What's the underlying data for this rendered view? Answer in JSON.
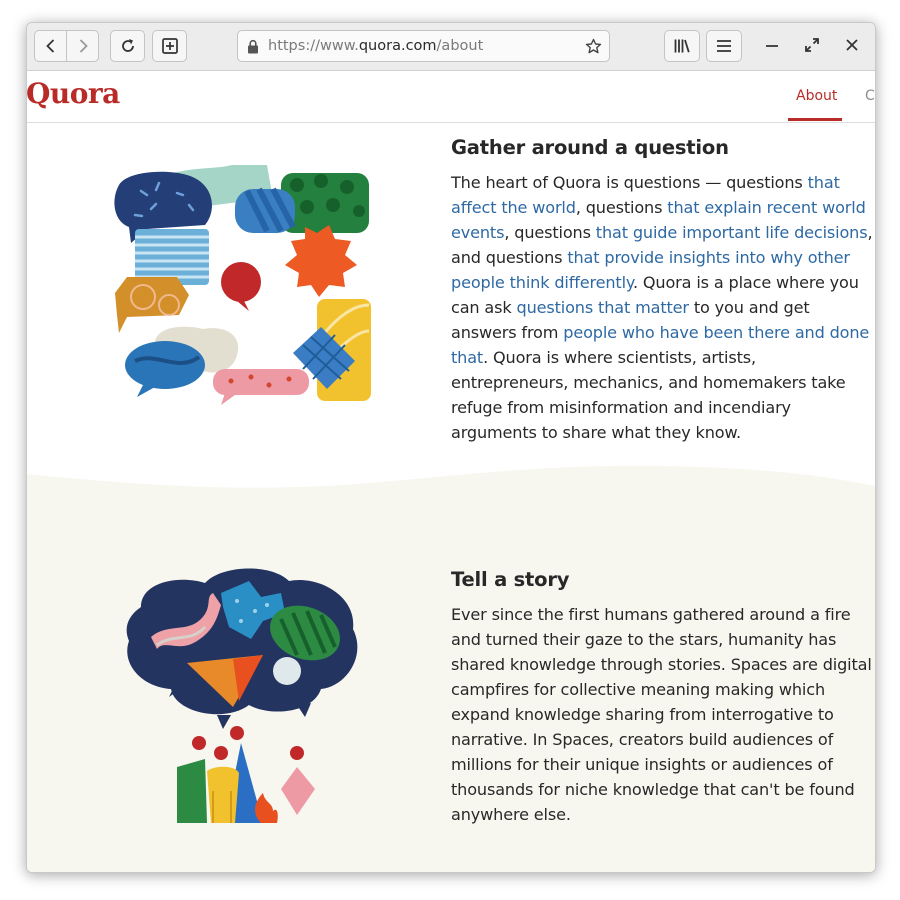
{
  "browser": {
    "url_prefix": "https://www.",
    "url_host": "quora.com",
    "url_path": "/about",
    "icons": [
      "back-icon",
      "forward-icon",
      "reload-icon",
      "new-tab-icon",
      "lock-icon",
      "bookmark-star-icon",
      "library-icon",
      "menu-icon",
      "minimize-icon",
      "maximize-icon",
      "close-icon"
    ]
  },
  "site": {
    "logo": "Quora",
    "nav": {
      "about": "About",
      "next_clipped": "C"
    }
  },
  "sections": [
    {
      "title": "Gather around a question",
      "paragraph": [
        {
          "t": "The heart of Quora is questions — questions "
        },
        {
          "t": "that affect the world",
          "link": true
        },
        {
          "t": ", questions "
        },
        {
          "t": "that explain recent world events",
          "link": true
        },
        {
          "t": ", questions "
        },
        {
          "t": "that guide important life decisions",
          "link": true
        },
        {
          "t": ", and questions "
        },
        {
          "t": "that provide insights into why other people think differently",
          "link": true
        },
        {
          "t": ". Quora is a place where you can ask "
        },
        {
          "t": "questions that matter",
          "link": true
        },
        {
          "t": " to you and get answers from "
        },
        {
          "t": "people who have been there and done that",
          "link": true
        },
        {
          "t": ". Quora is where scientists, artists, entrepreneurs, mechanics, and homemakers take refuge from misinformation and incendiary arguments to share what they know."
        }
      ]
    },
    {
      "title": "Tell a story",
      "paragraph": [
        {
          "t": "Ever since the first humans gathered around a fire and turned their gaze to the stars, humanity has shared knowledge through stories. Spaces are digital campfires for collective meaning making which expand knowledge sharing from interrogative to narrative. In Spaces, creators build audiences of millions for their unique insights or audiences of thousands for niche knowledge that can't be found anywhere else."
        }
      ]
    }
  ],
  "colors": {
    "brand": "#b92b27",
    "link": "#2e69a3",
    "text": "#282829",
    "cream": "#f8f7ef"
  }
}
